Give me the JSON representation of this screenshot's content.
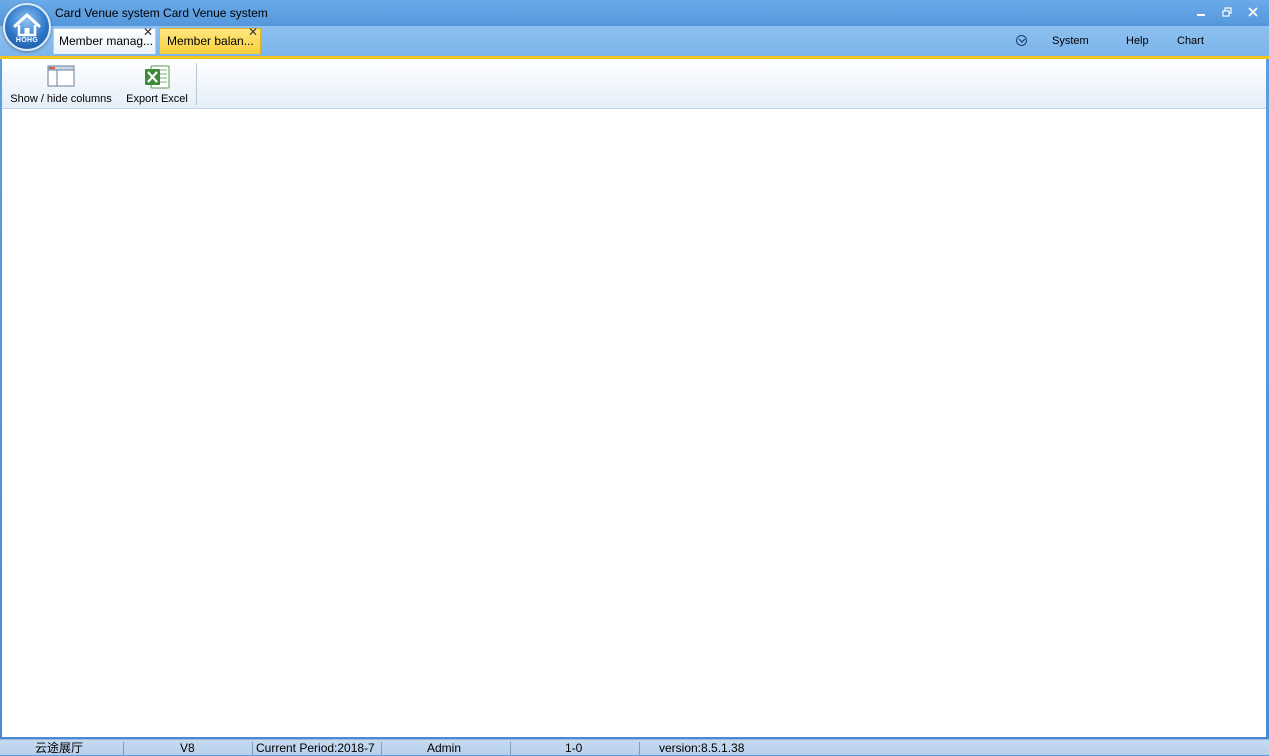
{
  "window": {
    "title": "Card Venue system Card Venue system",
    "logo_text": "HOHG",
    "controls": [
      "minimize-icon",
      "restore-icon",
      "close-icon"
    ]
  },
  "tabs": [
    {
      "label": "Member manag...",
      "active": false
    },
    {
      "label": "Member balan...",
      "active": true
    }
  ],
  "menu": {
    "system": "System",
    "help": "Help",
    "chart": "Chart"
  },
  "toolbar": {
    "show_hide_columns": "Show / hide columns",
    "export_excel": "Export Excel"
  },
  "statusbar": {
    "hall": "云途展厅",
    "version_short": "V8",
    "period": "Current Period:2018-7",
    "user": "Admin",
    "code": "1-0",
    "version": "version:8.5.1.38"
  },
  "colors": {
    "titlebar": "#5597dd",
    "active_tab": "#f8cf3c",
    "accent_line": "#f3c41a",
    "statusbar": "#c7dbf1"
  }
}
